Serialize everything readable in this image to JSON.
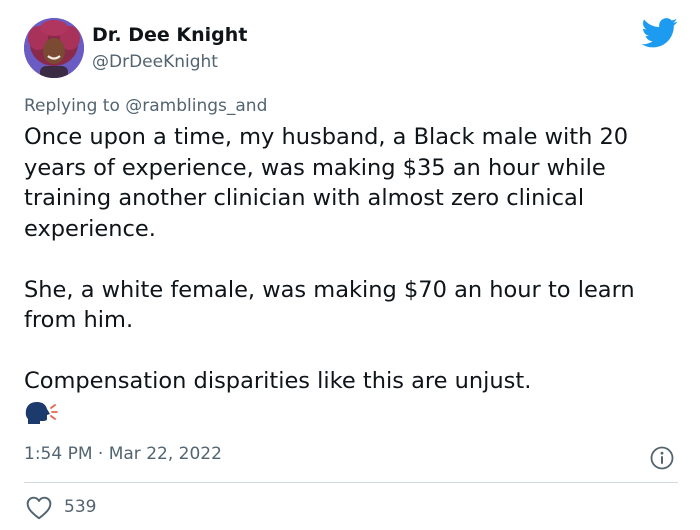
{
  "author": {
    "display_name": "Dr. Dee Knight",
    "handle": "@DrDeeKnight",
    "avatar_icon": "profile-photo"
  },
  "brand": {
    "icon": "twitter-bird-icon",
    "color": "#1d9bf0"
  },
  "reply": {
    "prefix": "Replying to",
    "mention": "@ramblings_and"
  },
  "tweet": {
    "paragraphs": [
      "Once upon a time, my husband, a Black male with 20 years of experience, was making $35 an hour while training another clinician with almost zero clinical experience.",
      "She, a white female, was making $70 an hour to learn from him.",
      "Compensation disparities like this are unjust."
    ],
    "emoji": "speaking-head-emoji",
    "timestamp": "1:54 PM · Mar 22, 2022"
  },
  "actions": {
    "like_icon": "heart-icon",
    "like_count": "539",
    "info_icon": "info-icon"
  },
  "colors": {
    "text": "#0f1419",
    "secondary": "#536471",
    "divider": "#cfd9de"
  }
}
